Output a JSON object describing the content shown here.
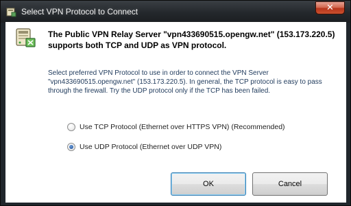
{
  "window": {
    "title": "Select VPN Protocol to Connect",
    "close_label": "✕"
  },
  "dialog": {
    "heading": "The Public VPN Relay Server \"vpn433690515.opengw.net\" (153.173.220.5) supports both TCP and UDP as VPN protocol.",
    "description": "Select preferred VPN Protocol to use in order to connect the VPN Server \"vpn433690515.opengw.net\" (153.173.220.5). In general, the TCP protocol is easy to pass through the firewall. Try the UDP protocol only if the TCP has been failed.",
    "options": [
      {
        "label": "Use TCP Protocol (Ethernet over HTTPS VPN) (Recommended)",
        "checked": false
      },
      {
        "label": "Use UDP Protocol (Ethernet over UDP VPN)",
        "checked": true
      }
    ],
    "ok_label": "OK",
    "cancel_label": "Cancel"
  },
  "icons": {
    "title": "vpn-server-icon",
    "header": "vpn-server-icon"
  },
  "colors": {
    "body_text": "#1e395b",
    "close_button": "#c9512f",
    "default_button_border": "#3c7fb1"
  }
}
